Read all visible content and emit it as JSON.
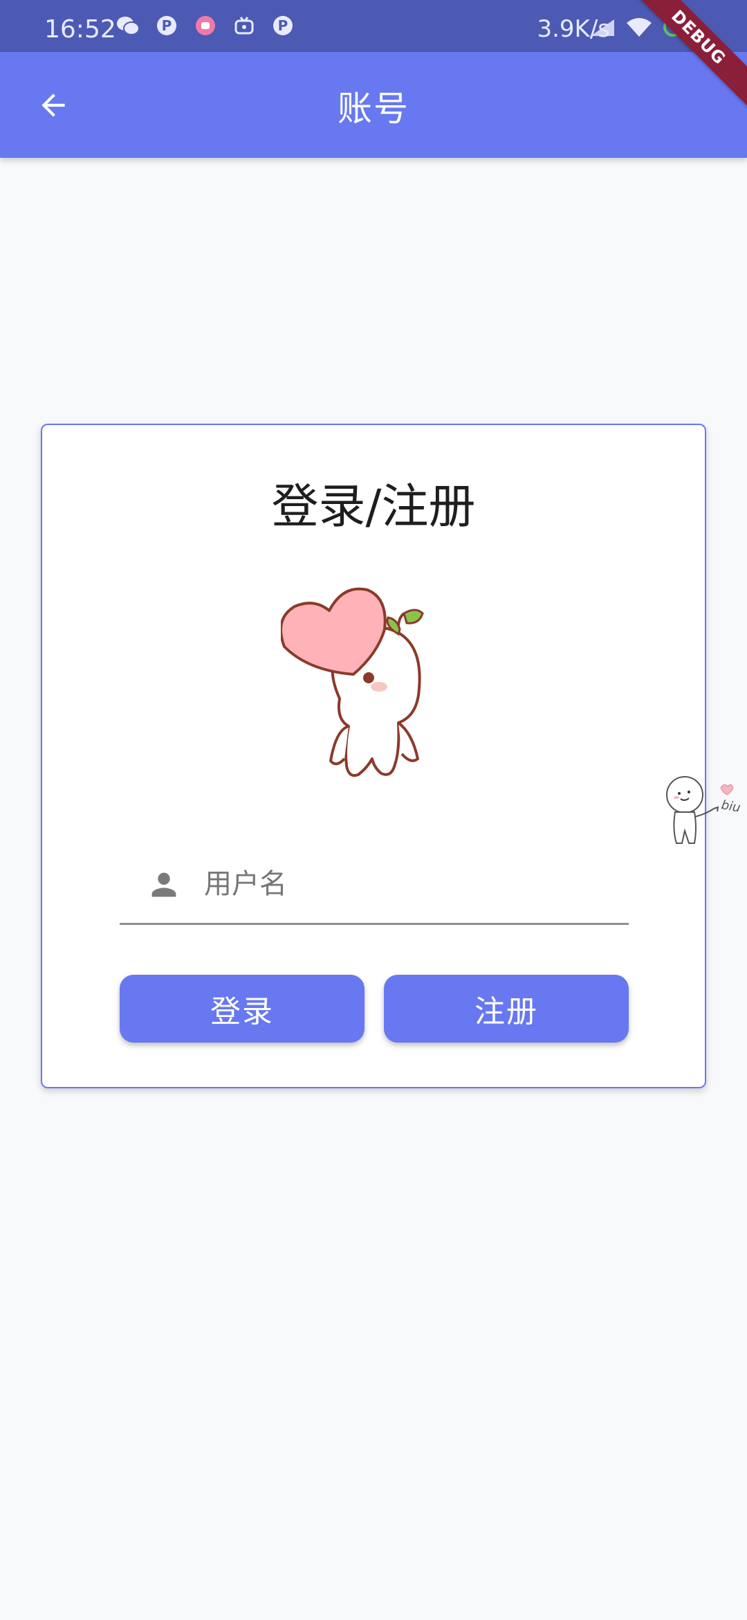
{
  "status_bar": {
    "time": "16:52",
    "network_speed": "3.9K/s",
    "left_icons": [
      "wechat-icon",
      "p-app-icon",
      "pink-app-icon",
      "tv-app-icon",
      "p-app-icon"
    ],
    "right_icons": [
      "signal-icon",
      "wifi-icon",
      "battery-icon"
    ]
  },
  "app_bar": {
    "title": "账号",
    "back_icon": "arrow-left-icon",
    "background": "#6778f0"
  },
  "debug_banner": {
    "label": "DEBUG"
  },
  "card": {
    "title": "登录/注册",
    "border_color": "#6778f0",
    "username": {
      "icon": "person-icon",
      "placeholder": "用户名",
      "value": ""
    },
    "login_button": "登录",
    "register_button": "注册"
  },
  "sticker": {
    "text": "biu"
  }
}
